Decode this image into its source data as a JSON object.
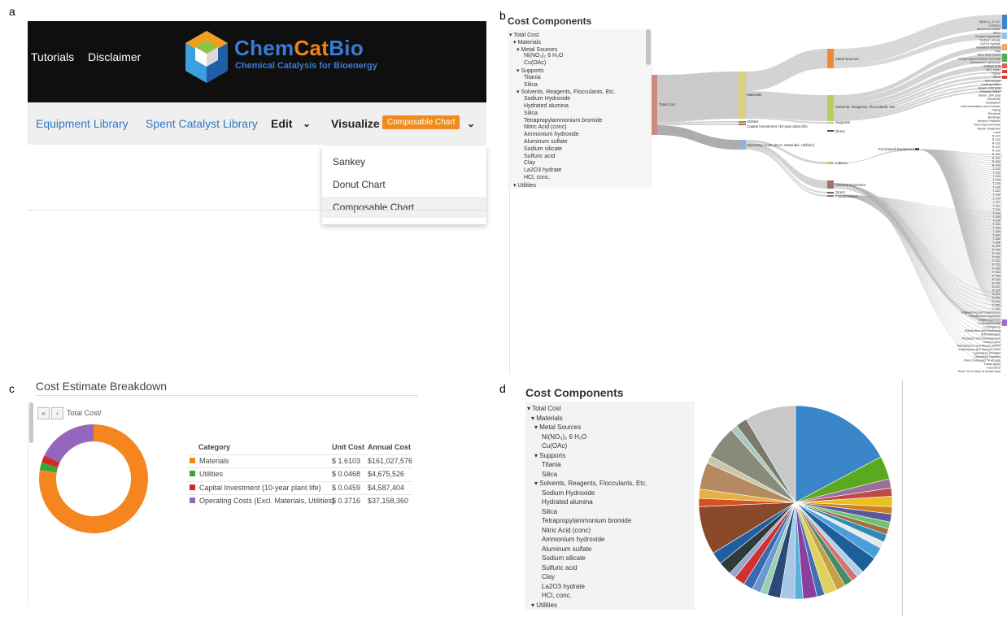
{
  "panel_labels": {
    "a": "a",
    "b": "b",
    "c": "c",
    "d": "d"
  },
  "panel_a": {
    "top_nav": {
      "tutorials": "Tutorials",
      "disclaimer": "Disclaimer"
    },
    "logo": {
      "chem": "Chem",
      "cat": "Cat",
      "bio": "Bio",
      "subtitle": "Chemical Catalysis for Bioenergy"
    },
    "nav": {
      "equipment": "Equipment Library",
      "spent": "Spent Catalyst Library",
      "edit": "Edit",
      "visualize": "Visualize",
      "badge": "Composable Chart"
    },
    "dropdown": [
      "Sankey",
      "Donut Chart",
      "Composable Chart"
    ],
    "dropdown_selected": 2,
    "colors": {
      "header_bg": "#0f0f0f",
      "link": "#2f77c4",
      "badge": "#f08c1e"
    }
  },
  "panel_b": {
    "title": "Cost Components",
    "tree": [
      "▾ Total Cost",
      "▾ Materials",
      "▾ Metal Sources",
      "Ni(NO₃)₂ 6 H₂O",
      "Cu(OAc)",
      "▾ Supports",
      "Titania",
      "Silica",
      "▾ Solvents, Reagents, Flocculants, Etc.",
      "Sodium Hydroxide",
      "Hydrated alumina",
      "Silica",
      "Tetrapropylammonium bromide",
      "Nitric Acid (conc)",
      "Ammonium hydroxide",
      "Aluminum sulfate",
      "Sodium silicate",
      "Sulfuric acid",
      "Clay",
      "La2O3 hydrate",
      "HCl, conc.",
      "▾ Utilities"
    ],
    "sankey_nodes": {
      "total_cost": "Total Cost",
      "materials": "Materials",
      "utilities": "Utilities",
      "capital": "Capital Investment (10-year plant life)",
      "operating": "Operating Costs (Excl. Materials, Utilities)",
      "metal_sources": "Metal Sources",
      "solvents": "Solvents, Reagents, Flocculants, Etc.",
      "supports": "Supports",
      "direct": "Direct",
      "indirect": "Indirect",
      "general": "General Expenses",
      "direct2": "Direct",
      "fixed": "Fixed/Indirect",
      "purchased": "Purchased Equipment"
    },
    "sankey_leaves": [
      "Ni(NO₃)₂ 6 H₂O",
      "Cu(OAc)",
      "Aluminum sulfate",
      "Silica",
      "Sodium Hydroxide",
      "Sodium silicate",
      "La2O3 hydrate",
      "Hydrated alumina",
      "Clay",
      "Nitric Acid (conc)",
      "Tetrapropylammonium bromide",
      "Ammonium hydroxide",
      "Sulfuric acid",
      "HCl, conc.",
      "Titania",
      "Silica",
      "Natural gas",
      "Cooling Water",
      "Steam, 150 psig",
      "Process Water",
      "Steam, 300 psig",
      "Electricity",
      "Installation",
      "Instrumentation and Controls",
      "Piping",
      "Electrical",
      "Buildings",
      "Service Facilities",
      "Yard Improvements",
      "Waste Treatment",
      "Land",
      "R-101",
      "R-102",
      "R-103",
      "R-201",
      "R-202",
      "R-203",
      "R-301",
      "R-302",
      "R-303",
      "T-101",
      "T-102",
      "T-103",
      "T-104",
      "T-105",
      "T-106",
      "T-107",
      "T-108",
      "T-109",
      "T-110",
      "T-201",
      "T-202",
      "T-203",
      "T-204",
      "T-205",
      "T-301",
      "T-302",
      "T-303",
      "T-304",
      "T-305",
      "T-306",
      "P-101",
      "P-102",
      "P-103",
      "P-201",
      "P-202",
      "P-203",
      "P-301",
      "P-302",
      "P-303",
      "H-101",
      "H-102",
      "H-201",
      "H-202",
      "H-301",
      "H-302",
      "C-101",
      "C-201",
      "C-301",
      "Engineering and Supervision",
      "Construction Expenses",
      "Legal Expenses",
      "Contractor's Fee",
      "Contingency",
      "Distribution and Marketing",
      "Administration",
      "Research and Development",
      "Direct Labor",
      "Maintenance and Repair (M&R)",
      "Supervisory and Clerical Labor",
      "Laboratory Charges",
      "Operating Supplies",
      "Plant Overhead, % of LM&",
      "Local Taxes",
      "Insurance",
      "Rent, % of value of rented land"
    ]
  },
  "panel_c": {
    "title": "Cost Estimate Breakdown",
    "nav_first": "«",
    "nav_prev": "‹",
    "path": "Total Cost/",
    "headers": {
      "category": "Category",
      "unit": "Unit Cost",
      "annual": "Annual Cost"
    },
    "rows": [
      {
        "category": "Materials",
        "unit": "$ 1.6103",
        "annual": "$161,027,576",
        "color": "#f5861f"
      },
      {
        "category": "Utilities",
        "unit": "$ 0.0468",
        "annual": "$4,675,526",
        "color": "#3aa63a"
      },
      {
        "category": "Capital Investment (10-year plant life)",
        "unit": "$ 0.0459",
        "annual": "$4,587,404",
        "color": "#d62728"
      },
      {
        "category": "Operating Costs (Excl. Materials, Utilities)",
        "unit": "$ 0.3716",
        "annual": "$37,158,360",
        "color": "#9467bd"
      }
    ],
    "chart_data": {
      "type": "pie",
      "categories": [
        "Materials",
        "Utilities",
        "Capital Investment (10-year plant life)",
        "Operating Costs (Excl. Materials, Utilities)"
      ],
      "values": [
        161027576,
        4675526,
        4587404,
        37158360
      ],
      "colors": [
        "#f5861f",
        "#3aa63a",
        "#d62728",
        "#9467bd"
      ],
      "donut": true
    }
  },
  "panel_d": {
    "title": "Cost Components",
    "tree": [
      "▾ Total Cost",
      "▾ Materials",
      "▾ Metal Sources",
      "Ni(NO₃)₂ 6 H₂O",
      "Cu(OAc)",
      "▾ Supports",
      "Titania",
      "Silica",
      "▾ Solvents, Reagents, Flocculants, Etc.",
      "Sodium Hydroxide",
      "Hydrated alumina",
      "Silica",
      "Tetrapropylammonium bromide",
      "Nitric Acid (conc)",
      "Ammonium hydroxide",
      "Aluminum sulfate",
      "Sodium silicate",
      "Sulfuric acid",
      "Clay",
      "La2O3 hydrate",
      "HCl, conc.",
      "▾ Utilities"
    ],
    "chart_data": {
      "type": "pie",
      "values": [
        20,
        4.5,
        1.8,
        1.6,
        2,
        1.4,
        1.6,
        1.3,
        1.2,
        1.5,
        1.3,
        2.3,
        3.4,
        1.4,
        1.3,
        1.6,
        1.8,
        2.5,
        1.5,
        2.7,
        1.6,
        2.8,
        2.5,
        1.4,
        1.7,
        1.9,
        2.1,
        1.3,
        2.6,
        2.4,
        9.4,
        1.6,
        1.8,
        5.2,
        1.5,
        6.4,
        1.3,
        2.2,
        9.9
      ],
      "colors": [
        "#3a86c8",
        "#5aaa20",
        "#9a6f9a",
        "#c04848",
        "#e8c020",
        "#d08020",
        "#5a5a9a",
        "#70c070",
        "#a07040",
        "#2e8bb5",
        "#e8e8e8",
        "#4a9fd8",
        "#1e5f9a",
        "#b0d0e8",
        "#d87070",
        "#4a8a6a",
        "#c8a040",
        "#e0d060",
        "#3f70b0",
        "#8a3fa0",
        "#5ab0d8",
        "#a8c8e8",
        "#2a4a7a",
        "#9ad0b0",
        "#6a9ad0",
        "#3a6ab0",
        "#d03030",
        "#98a8c8",
        "#2f3a3a",
        "#1f5fa0",
        "#8a4a2a",
        "#d85020",
        "#e8b040",
        "#b48a60",
        "#c8c8a8",
        "#8a8a7a",
        "#a8c8c0",
        "#7a7a6a",
        "#c8c8c8"
      ]
    }
  }
}
